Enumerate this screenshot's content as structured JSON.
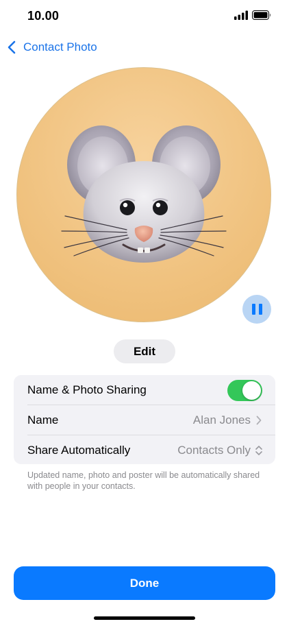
{
  "status_bar": {
    "time": "10.00",
    "icons": [
      "signal-icon",
      "battery-icon"
    ]
  },
  "nav": {
    "back_label": "Contact Photo",
    "back_icon": "chevron-left-icon"
  },
  "avatar": {
    "icon": "mouse-memoji",
    "background_color": "#f0c27f"
  },
  "playback": {
    "icon": "pause-icon",
    "state": "playing"
  },
  "edit": {
    "label": "Edit"
  },
  "settings": {
    "rows": [
      {
        "label": "Name & Photo Sharing",
        "toggle_on": true
      },
      {
        "label": "Name",
        "value": "Alan Jones",
        "accessory": "chevron-right-icon"
      },
      {
        "label": "Share Automatically",
        "value": "Contacts Only",
        "accessory": "up-down-icon"
      }
    ],
    "footnote": "Updated name, photo and poster will be automatically shared with people in your contacts."
  },
  "done": {
    "label": "Done"
  },
  "colors": {
    "accent": "#0a7aff",
    "toggle_on": "#34c759",
    "group_background": "#f2f2f6",
    "secondary_text": "#8a8a8e"
  }
}
